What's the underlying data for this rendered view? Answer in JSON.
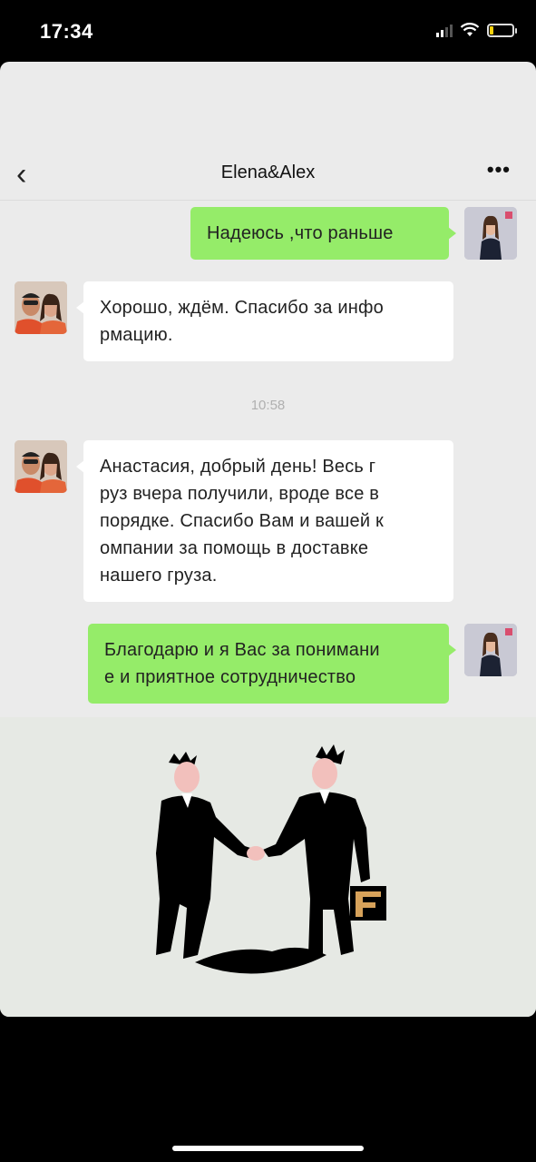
{
  "status_bar": {
    "time": "17:34"
  },
  "nav": {
    "back_icon": "chevron-left-icon",
    "title": "Elena&Alex",
    "more_label": "•••"
  },
  "messages": [
    {
      "from": "me",
      "text": "Надеюсь ,что раньше"
    },
    {
      "from": "them",
      "text": "Хорошо, ждём. Спасибо за инфо\nрмацию."
    },
    {
      "from": "them",
      "text": "Анастасия, добрый день! Весь г\nруз вчера получили, вроде все в\nпорядке. Спасибо Вам и вашей к\nомпании за помощь в доставке\nнашего груза."
    },
    {
      "from": "me",
      "text": "Благодарю и я Вас за понимани\nе и приятное сотрудничество"
    }
  ],
  "timestamp": "10:58",
  "colors": {
    "my_bubble": "#95ec69",
    "their_bubble": "#ffffff",
    "chat_bg": "#ebebeb"
  }
}
